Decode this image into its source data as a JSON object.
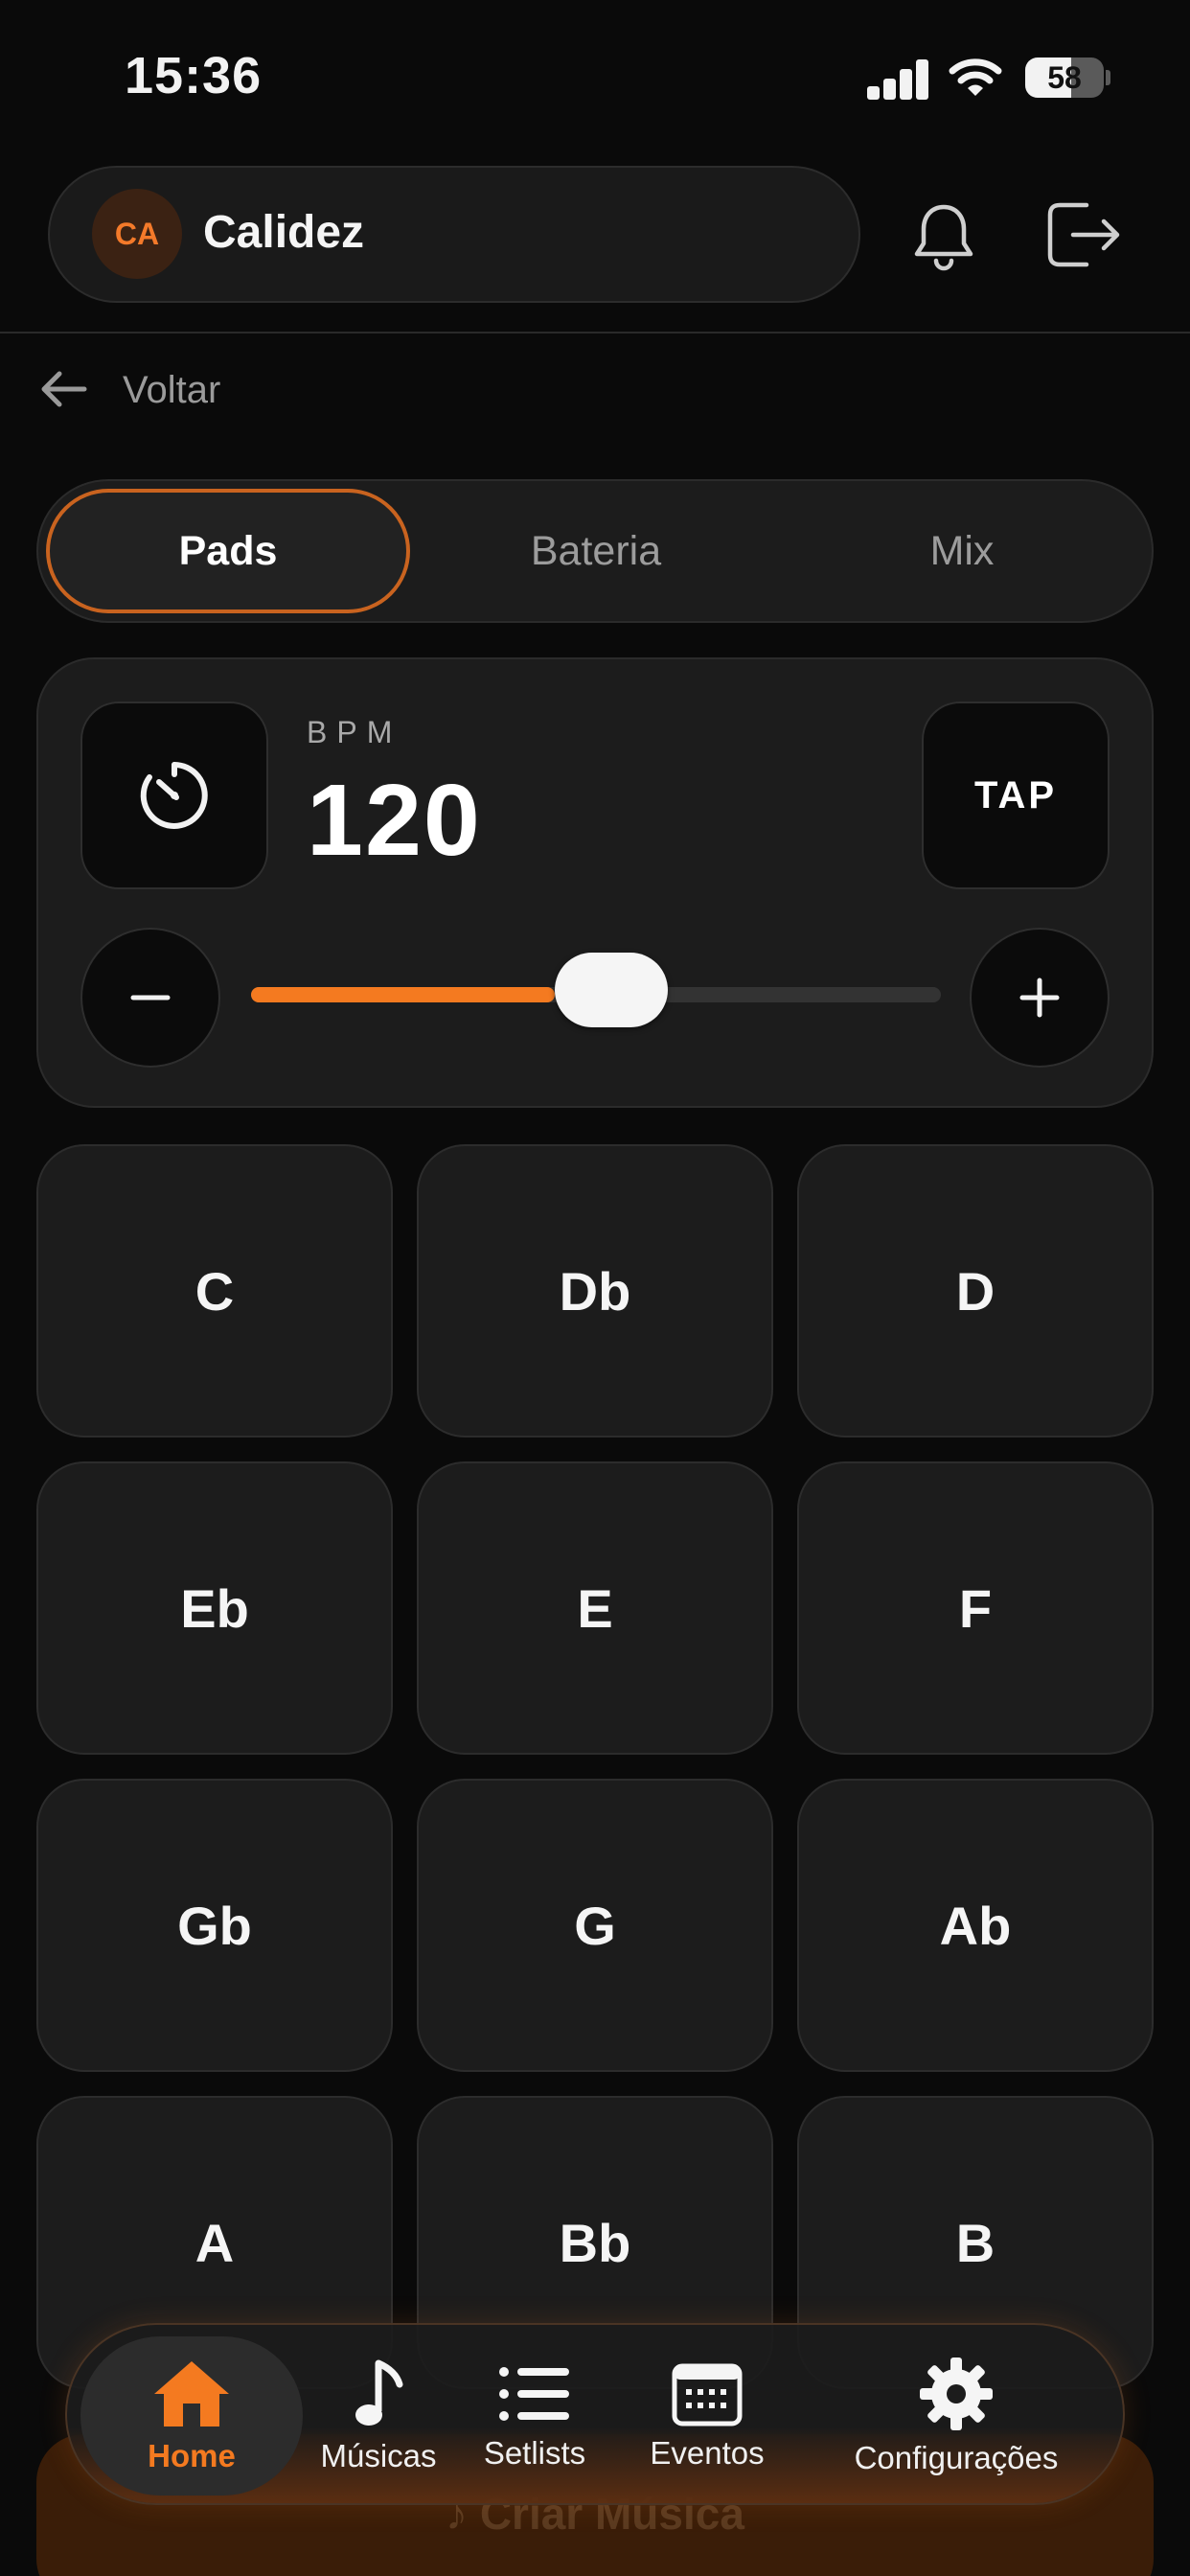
{
  "status_bar": {
    "time": "15:36",
    "battery": "58",
    "battery_level": 0.58
  },
  "header": {
    "avatar_initials": "CA",
    "user_name": "Calidez"
  },
  "back": {
    "label": "Voltar"
  },
  "tabs": [
    {
      "label": "Pads",
      "active": true
    },
    {
      "label": "Bateria",
      "active": false
    },
    {
      "label": "Mix",
      "active": false
    }
  ],
  "bpm": {
    "label": "BPM",
    "value": "120",
    "tap_label": "TAP",
    "slider_level": 0.44
  },
  "pads": [
    "C",
    "Db",
    "D",
    "Eb",
    "E",
    "F",
    "Gb",
    "G",
    "Ab",
    "A",
    "Bb",
    "B"
  ],
  "create_button": {
    "label": "♪  Criar Música"
  },
  "nav": [
    {
      "label": "Home",
      "icon": "home-icon",
      "active": true
    },
    {
      "label": "Músicas",
      "icon": "music-note-icon",
      "active": false
    },
    {
      "label": "Setlists",
      "icon": "list-icon",
      "active": false
    },
    {
      "label": "Eventos",
      "icon": "calendar-icon",
      "active": false
    },
    {
      "label": "Configurações",
      "icon": "gear-icon",
      "active": false
    }
  ],
  "colors": {
    "accent": "#f47a20",
    "background": "#0a0a0a",
    "card": "#1c1c1c"
  }
}
